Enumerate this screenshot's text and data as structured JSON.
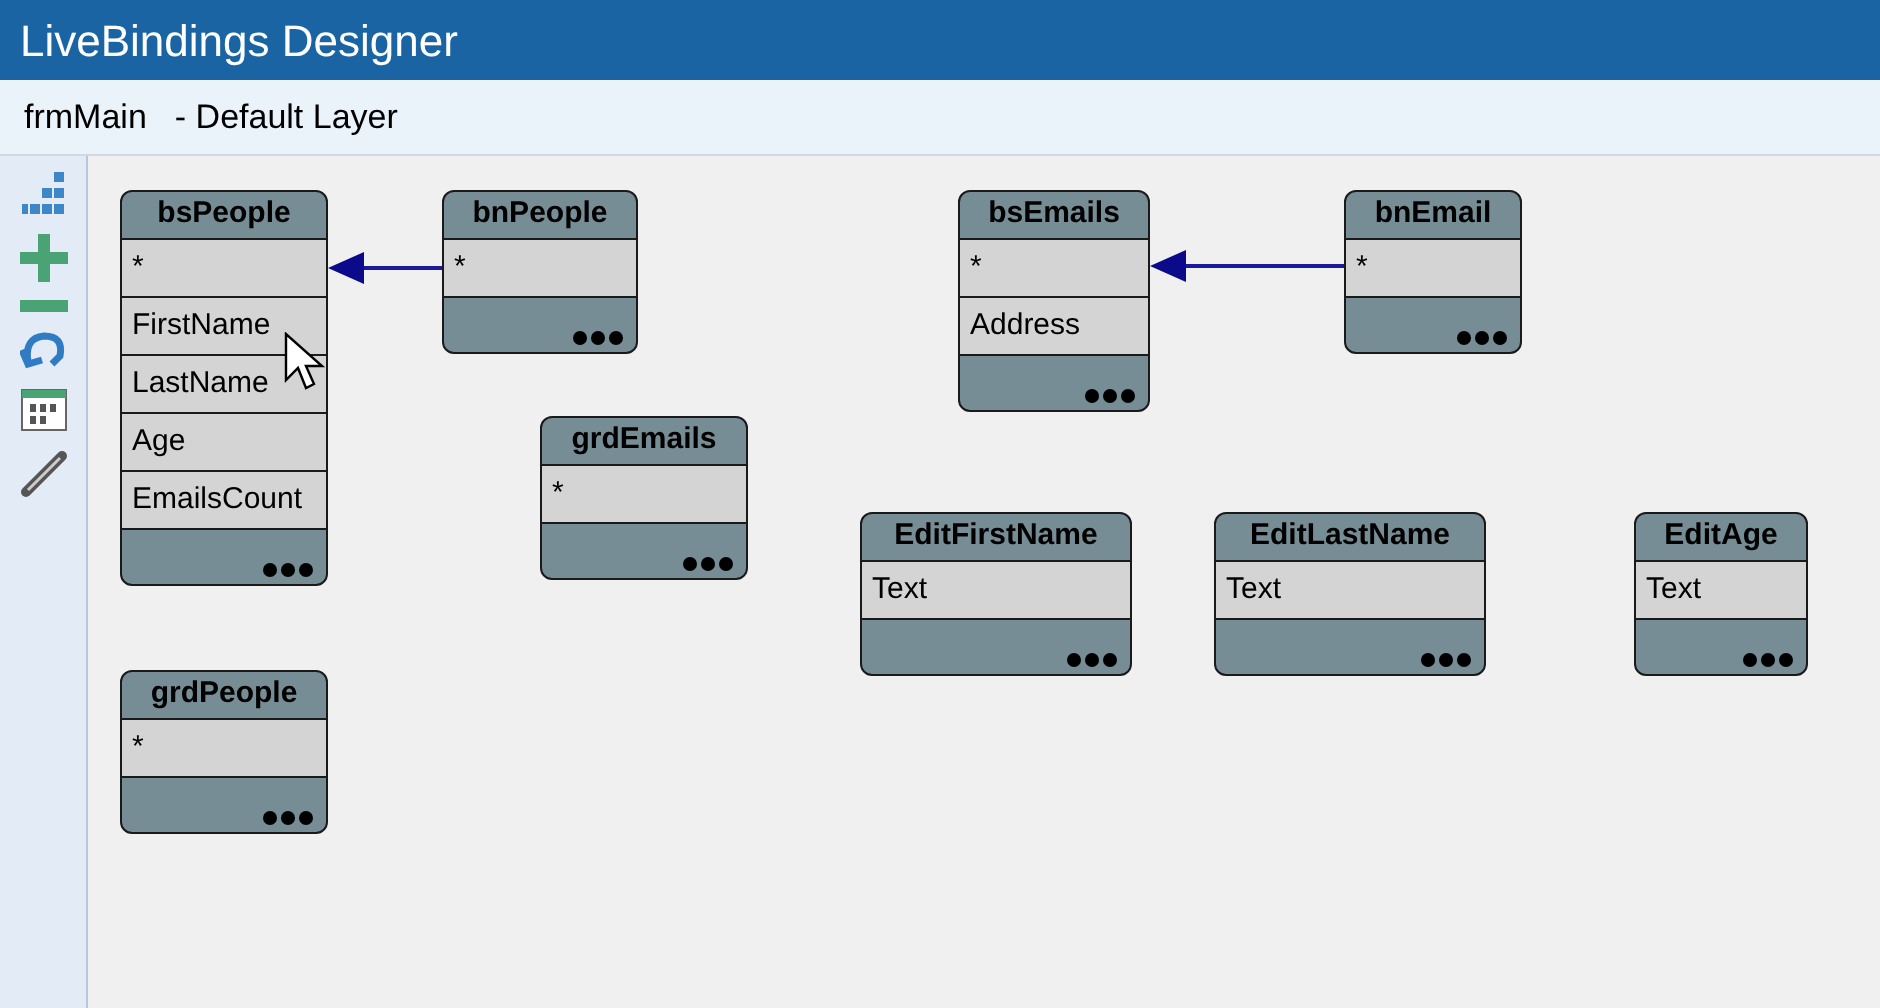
{
  "window": {
    "title": "LiveBindings Designer"
  },
  "layer_bar": {
    "form": "frmMain",
    "layer": "- Default Layer"
  },
  "nodes": [
    {
      "title": "bsPeople",
      "fields": [
        "*",
        "FirstName",
        "LastName",
        "Age",
        "EmailsCount"
      ]
    },
    {
      "title": "bnPeople",
      "fields": [
        "*"
      ]
    },
    {
      "title": "bsEmails",
      "fields": [
        "*",
        "Address"
      ]
    },
    {
      "title": "bnEmail",
      "fields": [
        "*"
      ]
    },
    {
      "title": "grdEmails",
      "fields": [
        "*"
      ]
    },
    {
      "title": "EditFirstName",
      "fields": [
        "Text"
      ]
    },
    {
      "title": "EditLastName",
      "fields": [
        "Text"
      ]
    },
    {
      "title": "EditAge",
      "fields": [
        "Text"
      ]
    },
    {
      "title": "grdPeople",
      "fields": [
        "*"
      ]
    }
  ]
}
